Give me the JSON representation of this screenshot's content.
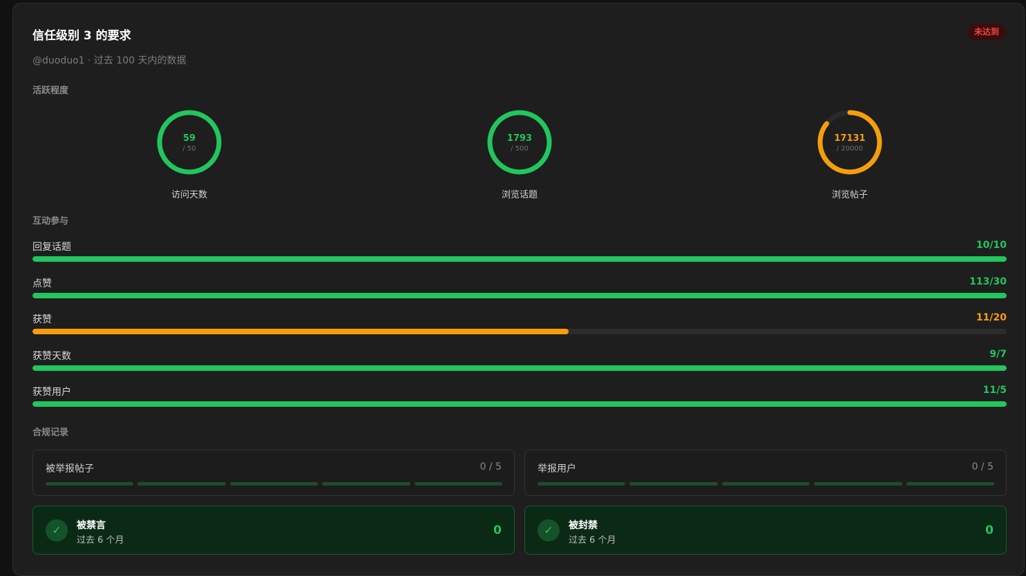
{
  "header": {
    "title": "信任级别 3 的要求",
    "status_badge": "未达到",
    "subtitle": "@duoduo1 · 过去 100 天内的数据"
  },
  "activity": {
    "section_label": "活跃程度",
    "gauges": [
      {
        "label": "访问天数",
        "value": "59",
        "target": "/ 50",
        "progress": 1.0,
        "color": "#22c55e"
      },
      {
        "label": "浏览话题",
        "value": "1793",
        "target": "/ 500",
        "progress": 1.0,
        "color": "#22c55e"
      },
      {
        "label": "浏览帖子",
        "value": "17131",
        "target": "/ 20000",
        "progress": 0.857,
        "color": "#f59e0b"
      }
    ]
  },
  "engagement": {
    "section_label": "互动参与",
    "rows": [
      {
        "label": "回复话题",
        "value": "10/10",
        "progress": 1.0,
        "color": "#22c55e"
      },
      {
        "label": "点赞",
        "value": "113/30",
        "progress": 1.0,
        "color": "#22c55e"
      },
      {
        "label": "获赞",
        "value": "11/20",
        "progress": 0.55,
        "color": "#f59e0b"
      },
      {
        "label": "获赞天数",
        "value": "9/7",
        "progress": 1.0,
        "color": "#22c55e"
      },
      {
        "label": "获赞用户",
        "value": "11/5",
        "progress": 1.0,
        "color": "#22c55e"
      }
    ]
  },
  "compliance": {
    "section_label": "合规记录",
    "records": [
      {
        "label": "被举报帖子",
        "value": "0 / 5"
      },
      {
        "label": "举报用户",
        "value": "0 / 5"
      }
    ],
    "sanctions": [
      {
        "title": "被禁言",
        "subtitle": "过去 6 个月",
        "value": "0"
      },
      {
        "title": "被封禁",
        "subtitle": "过去 6 个月",
        "value": "0"
      }
    ]
  }
}
